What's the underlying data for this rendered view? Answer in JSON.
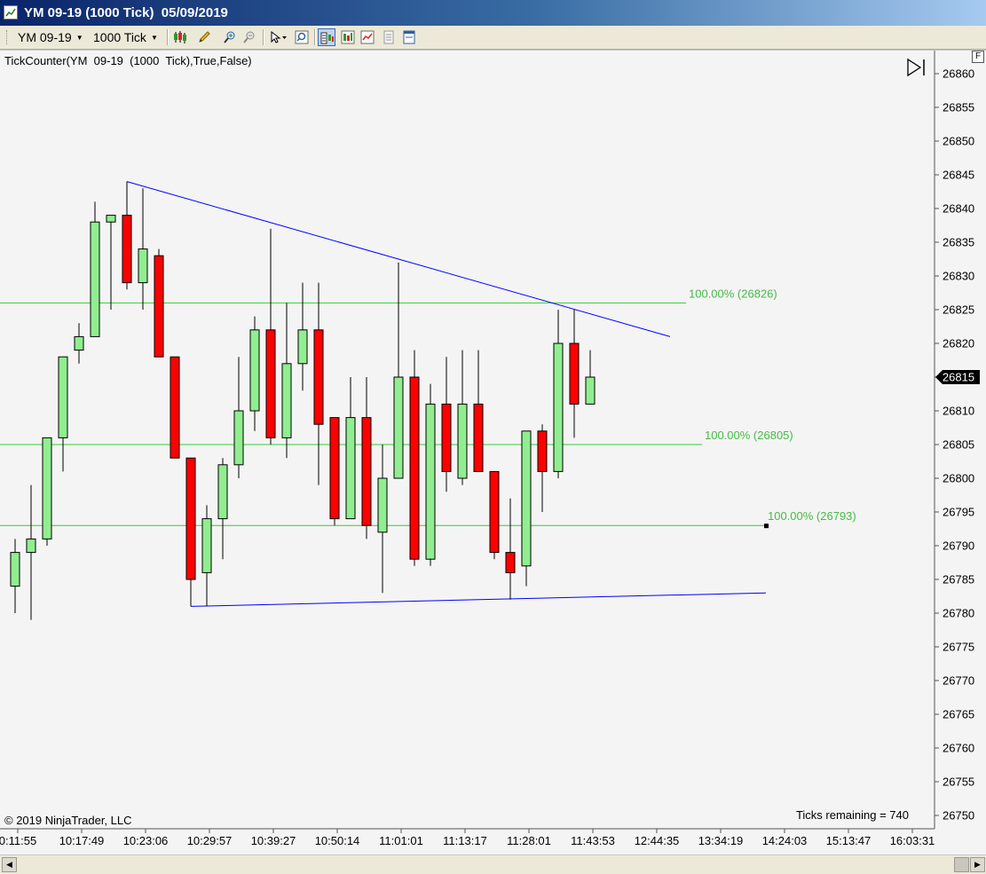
{
  "window": {
    "title": "YM 09-19 (1000 Tick)  05/09/2019"
  },
  "toolbar": {
    "instrument": "YM 09-19",
    "interval": "1000 Tick",
    "icons": [
      "chart-style-icon",
      "drawing-pencil-icon",
      "zoom-in-icon",
      "zoom-out-icon",
      "cursor-pointer-icon",
      "magnifier-icon",
      "data-box-icon",
      "bar-chart-icon",
      "line-chart-icon",
      "properties-icon",
      "panel-icon"
    ]
  },
  "chart_data": {
    "type": "candlestick",
    "indicator_label": "TickCounter(YM  09-19  (1000  Tick),True,False)",
    "copyright": "© 2019 NinjaTrader, LLC",
    "ticks_remaining": "Ticks remaining = 740",
    "last_price": "26815",
    "ylim": [
      26748,
      26864
    ],
    "y_ticks": [
      "26860",
      "26855",
      "26850",
      "26845",
      "26840",
      "26835",
      "26830",
      "26825",
      "26820",
      "26815",
      "26810",
      "26805",
      "26800",
      "26795",
      "26790",
      "26785",
      "26780",
      "26775",
      "26770",
      "26765",
      "26760",
      "26755",
      "26750"
    ],
    "x_ticks": [
      "0:11:55",
      "10:17:49",
      "10:23:06",
      "10:29:57",
      "10:39:27",
      "10:50:14",
      "11:01:01",
      "11:13:17",
      "11:28:01",
      "11:43:53",
      "12:44:35",
      "13:34:19",
      "14:24:03",
      "15:13:47",
      "16:03:31"
    ],
    "candles": [
      {
        "o": 26784,
        "h": 26791,
        "l": 26780,
        "c": 26789
      },
      {
        "o": 26789,
        "h": 26799,
        "l": 26779,
        "c": 26791
      },
      {
        "o": 26791,
        "h": 26806,
        "l": 26790,
        "c": 26806
      },
      {
        "o": 26806,
        "h": 26818,
        "l": 26801,
        "c": 26818
      },
      {
        "o": 26819,
        "h": 26823,
        "l": 26817,
        "c": 26821
      },
      {
        "o": 26821,
        "h": 26841,
        "l": 26821,
        "c": 26838
      },
      {
        "o": 26838,
        "h": 26839,
        "l": 26825,
        "c": 26839
      },
      {
        "o": 26839,
        "h": 26844,
        "l": 26828,
        "c": 26829
      },
      {
        "o": 26829,
        "h": 26843,
        "l": 26825,
        "c": 26834
      },
      {
        "o": 26833,
        "h": 26834,
        "l": 26818,
        "c": 26818
      },
      {
        "o": 26818,
        "h": 26818,
        "l": 26803,
        "c": 26803
      },
      {
        "o": 26803,
        "h": 26803,
        "l": 26781,
        "c": 26785
      },
      {
        "o": 26786,
        "h": 26796,
        "l": 26781,
        "c": 26794
      },
      {
        "o": 26794,
        "h": 26803,
        "l": 26788,
        "c": 26802
      },
      {
        "o": 26802,
        "h": 26818,
        "l": 26800,
        "c": 26810
      },
      {
        "o": 26810,
        "h": 26824,
        "l": 26807,
        "c": 26822
      },
      {
        "o": 26822,
        "h": 26837,
        "l": 26805,
        "c": 26806
      },
      {
        "o": 26806,
        "h": 26826,
        "l": 26803,
        "c": 26817
      },
      {
        "o": 26817,
        "h": 26829,
        "l": 26813,
        "c": 26822
      },
      {
        "o": 26822,
        "h": 26829,
        "l": 26799,
        "c": 26808
      },
      {
        "o": 26809,
        "h": 26809,
        "l": 26793,
        "c": 26794
      },
      {
        "o": 26794,
        "h": 26815,
        "l": 26794,
        "c": 26809
      },
      {
        "o": 26809,
        "h": 26815,
        "l": 26791,
        "c": 26793
      },
      {
        "o": 26792,
        "h": 26805,
        "l": 26783,
        "c": 26800
      },
      {
        "o": 26800,
        "h": 26832,
        "l": 26800,
        "c": 26815
      },
      {
        "o": 26815,
        "h": 26819,
        "l": 26787,
        "c": 26788
      },
      {
        "o": 26788,
        "h": 26814,
        "l": 26787,
        "c": 26811
      },
      {
        "o": 26811,
        "h": 26818,
        "l": 26798,
        "c": 26801
      },
      {
        "o": 26800,
        "h": 26819,
        "l": 26799,
        "c": 26811
      },
      {
        "o": 26811,
        "h": 26819,
        "l": 26801,
        "c": 26801
      },
      {
        "o": 26801,
        "h": 26801,
        "l": 26788,
        "c": 26789
      },
      {
        "o": 26789,
        "h": 26797,
        "l": 26782,
        "c": 26786
      },
      {
        "o": 26787,
        "h": 26807,
        "l": 26784,
        "c": 26807
      },
      {
        "o": 26807,
        "h": 26808,
        "l": 26795,
        "c": 26801
      },
      {
        "o": 26801,
        "h": 26825,
        "l": 26800,
        "c": 26820
      },
      {
        "o": 26820,
        "h": 26825,
        "l": 26806,
        "c": 26811
      },
      {
        "o": 26811,
        "h": 26819,
        "l": 26811,
        "c": 26815
      }
    ],
    "horizontal_lines": [
      {
        "label": "100.00% (26826)",
        "value": 26826
      },
      {
        "label": "100.00% (26805)",
        "value": 26805
      },
      {
        "label": "100.00% (26793)",
        "value": 26793
      }
    ],
    "trend_lines": [
      {
        "start_bar": 7,
        "start_price": 26844,
        "end_bar": 41,
        "end_price": 26821
      },
      {
        "start_bar": 11,
        "start_price": 26781,
        "end_bar": 47,
        "end_price": 26783
      }
    ],
    "colors": {
      "up": "#90ee90",
      "down": "#ff0000",
      "wick": "#000000",
      "horizontal_line": "#32cd32",
      "horizontal_label": "#44bb44",
      "trend_line": "#0000ff",
      "background": "#f4f4f4"
    }
  }
}
